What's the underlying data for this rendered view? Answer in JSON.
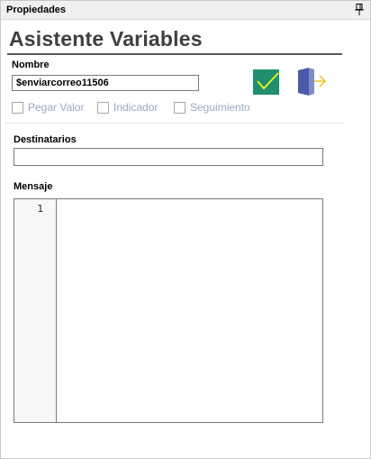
{
  "panel": {
    "title": "Propiedades"
  },
  "form": {
    "heading": "Asistente Variables",
    "nombre_label": "Nombre",
    "nombre_value": "$enviarcorreo11506",
    "options": [
      "Pegar Valor",
      "Indicador",
      "Seguimiento"
    ],
    "destinatarios_label": "Destinatarios",
    "destinatarios_value": "",
    "mensaje_label": "Mensaje",
    "line_number": "1"
  },
  "colors": {
    "accept": "#1f8f6e",
    "door": "#4a5aa8",
    "arrow": "#f0c020",
    "checkbox_text": "#9aa9c0"
  },
  "icons": {
    "accept": "check-icon",
    "exit": "exit-door-icon",
    "pin": "pin-icon"
  }
}
